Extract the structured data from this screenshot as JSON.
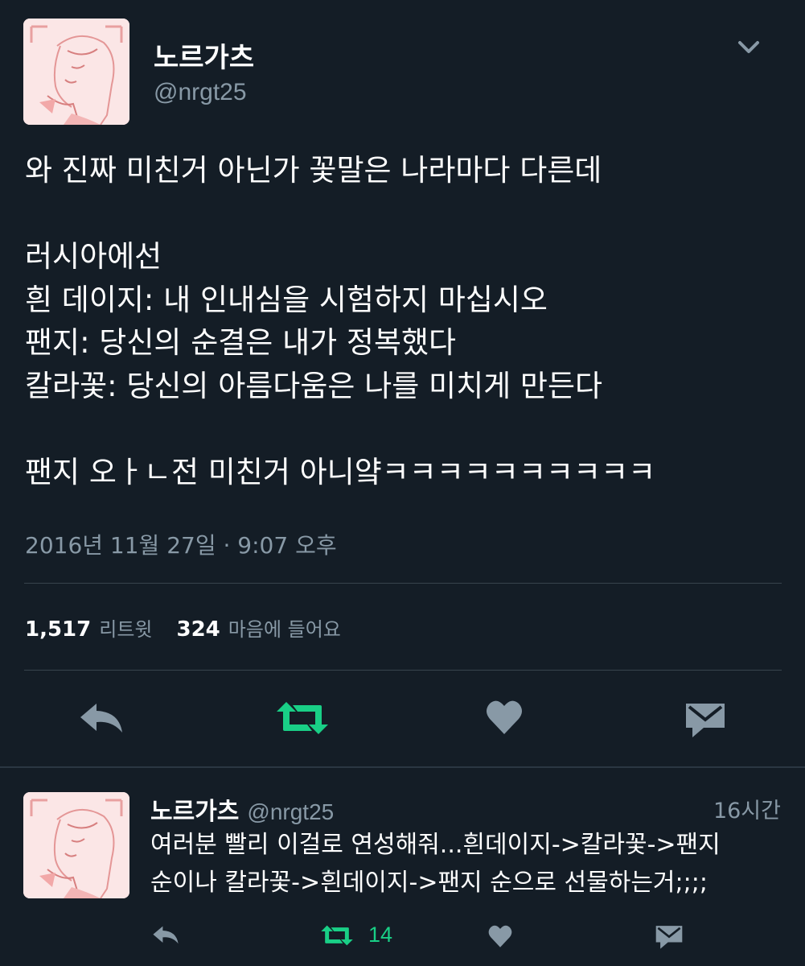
{
  "main_tweet": {
    "author": {
      "name": "노르가츠",
      "handle": "@nrgt25"
    },
    "menu_icon": "chevron-down-icon",
    "text_lines": [
      "와 진짜 미친거 아닌가 꽃말은 나라마다 다른데",
      "",
      "러시아에선",
      "흰 데이지: 내 인내심을 시험하지 마십시오",
      "팬지: 당신의 순결은 내가 정복했다",
      "칼라꽃: 당신의 아름다움은 나를 미치게 만든다",
      "",
      "팬지 오ㅏㄴ전 미친거 아니얔ㅋㅋㅋㅋㅋㅋㅋㅋㅋㅋ"
    ],
    "timestamp": "2016년 11월 27일 · 9:07 오후",
    "stats": {
      "retweets_count": "1,517",
      "retweets_label": "리트윗",
      "likes_count": "324",
      "likes_label": "마음에 들어요"
    },
    "actions": {
      "reply_icon": "reply-icon",
      "retweet_icon": "retweet-icon",
      "like_icon": "heart-icon",
      "message_icon": "envelope-icon"
    }
  },
  "reply_tweet": {
    "author": {
      "name": "노르가츠",
      "handle": "@nrgt25"
    },
    "time": "16시간",
    "text_lines": [
      "여러분 빨리 이걸로 연성해줘...흰데이지->칼라꽃->팬지",
      "순이나 칼라꽃->흰데이지->팬지 순으로 선물하는거;;;;"
    ],
    "retweet_count": "14"
  },
  "colors": {
    "background": "#141d26",
    "divider": "#38444d",
    "secondary_text": "#8899a6",
    "icon_gray": "#8899a6",
    "retweet_green": "#19cf86",
    "avatar_bg": "#fbe3e3"
  }
}
